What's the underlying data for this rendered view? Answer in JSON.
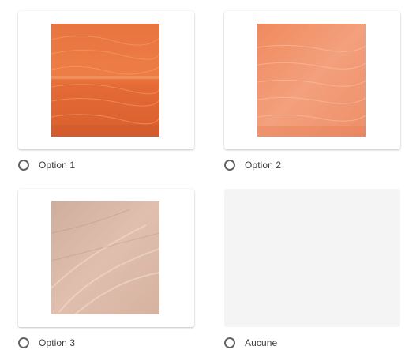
{
  "options": [
    {
      "label": "Option 1",
      "image": "salmon-fillet-deep-orange"
    },
    {
      "label": "Option 2",
      "image": "salmon-fillet-light-orange"
    },
    {
      "label": "Option 3",
      "image": "salmon-fillet-pale-pink"
    },
    {
      "label": "Aucune",
      "image": ""
    }
  ],
  "colors": {
    "card_background": "#ffffff",
    "empty_card_background": "#f4f4f4",
    "radio_border": "#5f6368",
    "label_text": "#3c4043"
  }
}
